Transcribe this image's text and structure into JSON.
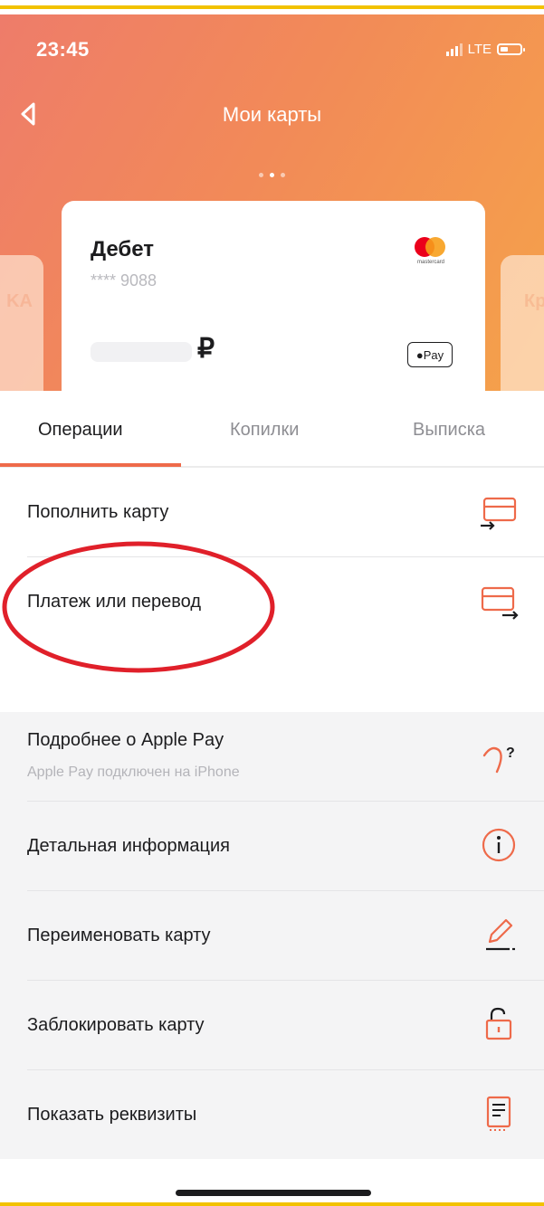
{
  "status_bar": {
    "time": "23:45",
    "network": "LTE"
  },
  "header": {
    "title": "Мои карты"
  },
  "card": {
    "name": "Дебет",
    "number": "**** 9088",
    "currency": "₽",
    "brand_label": "mastercard",
    "wallet": "Pay"
  },
  "side_cards": {
    "left_ghost": "KA",
    "right_ghost": "Кр"
  },
  "tabs": [
    {
      "label": "Операции",
      "active": true
    },
    {
      "label": "Копилки",
      "active": false
    },
    {
      "label": "Выписка",
      "active": false
    }
  ],
  "operations": [
    {
      "label": "Пополнить карту",
      "icon": "card-in-icon"
    },
    {
      "label": "Платеж или перевод",
      "icon": "card-out-icon"
    }
  ],
  "settings": [
    {
      "label": "Подробнее о Apple Pay",
      "sublabel": "Apple Pay подключен на iPhone",
      "icon": "apple-pay-help-icon"
    },
    {
      "label": "Детальная информация",
      "icon": "info-icon"
    },
    {
      "label": "Переименовать карту",
      "icon": "pencil-icon"
    },
    {
      "label": "Заблокировать карту",
      "icon": "lock-icon"
    },
    {
      "label": "Показать реквизиты",
      "icon": "receipt-icon"
    }
  ],
  "colors": {
    "accent": "#ee6a4a",
    "annotation": "#e0202a",
    "gradient_start": "#ee7c6a",
    "gradient_end": "#f5a24a"
  }
}
